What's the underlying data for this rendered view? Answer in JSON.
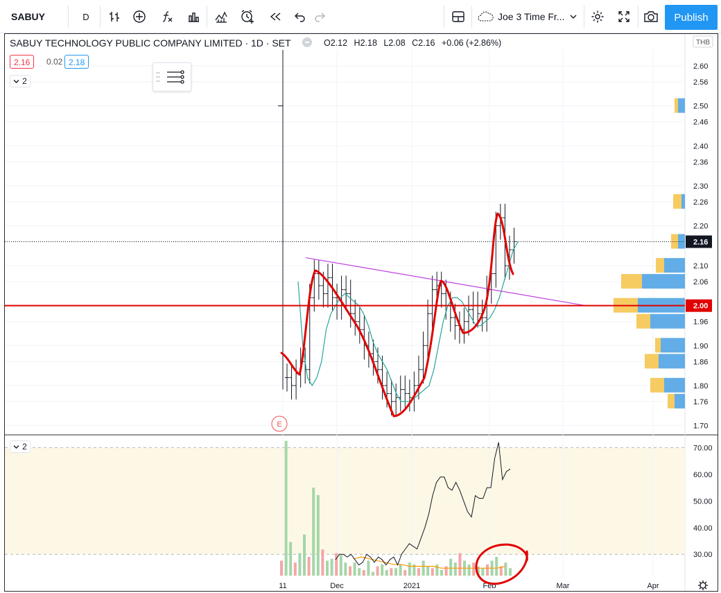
{
  "toolbar": {
    "symbol": "SABUY",
    "interval": "D",
    "layout_name": "Joe 3 Time Fr...",
    "publish_label": "Publish",
    "icons": [
      "bar-style-icon",
      "add-compare-icon",
      "indicators-icon",
      "financials-icon",
      "templates-icon",
      "alert-icon",
      "replay-icon",
      "undo-icon",
      "redo-icon",
      "layout-icon",
      "cloud-icon",
      "settings-icon",
      "fullscreen-icon",
      "camera-icon"
    ]
  },
  "legend": {
    "title": "SABUY TECHNOLOGY PUBLIC COMPANY LIMITED · 1D · SET",
    "open": "O2.12",
    "high": "H2.18",
    "low": "L2.08",
    "close": "C2.16",
    "change": "+0.06 (+2.86%)",
    "bid": "2.16",
    "spread": "0.02",
    "ask": "2.18",
    "pane_count": "2",
    "volume_pane_count": "2"
  },
  "colors": {
    "up": "#26a69a",
    "down": "#ef5350",
    "accent": "#2196f3",
    "trendline": "#c040e0",
    "horizontal_line": "#e00000",
    "annotation": "#e00000"
  },
  "chart_data": [
    {
      "type": "bar",
      "title": "SABUY TECHNOLOGY PUBLIC COMPANY LIMITED · 1D · SET",
      "currency": "THB",
      "y_ticks": [
        "1.70",
        "1.76",
        "1.80",
        "1.86",
        "1.90",
        "1.96",
        "2.00",
        "2.06",
        "2.10",
        "2.16",
        "2.20",
        "2.26",
        "2.30",
        "2.36",
        "2.40",
        "2.46",
        "2.50",
        "2.56",
        "2.60"
      ],
      "ylim": [
        1.68,
        2.64
      ],
      "x_ticks": [
        "11",
        "Dec",
        "2021",
        "Feb",
        "Mar",
        "Apr"
      ],
      "last_price": "2.16",
      "horizontal_level": "2.00",
      "earnings_marker": "E",
      "ohlc_close_path": [
        1.82,
        1.8,
        1.83,
        1.86,
        1.84,
        2.02,
        2.08,
        2.05,
        2.03,
        2.07,
        2.02,
        2.0,
        2.04,
        2.03,
        1.98,
        1.96,
        1.94,
        1.9,
        1.88,
        1.86,
        1.84,
        1.8,
        1.78,
        1.76,
        1.77,
        1.79,
        1.78,
        1.77,
        1.8,
        1.84,
        1.9,
        1.98,
        2.04,
        2.05,
        2.03,
        2.0,
        1.97,
        1.95,
        1.94,
        1.96,
        1.99,
        2.0,
        1.98,
        1.97,
        2.04,
        2.08,
        2.2,
        2.22,
        2.1,
        2.14,
        2.16
      ],
      "moving_average": [
        2.06,
        1.9,
        1.82,
        1.8,
        1.82,
        1.86,
        1.94,
        1.98,
        2.0,
        2.02,
        2.03,
        2.02,
        2.01,
        2.0,
        1.98,
        1.95,
        1.91,
        1.88,
        1.86,
        1.84,
        1.81,
        1.78,
        1.76,
        1.76,
        1.76,
        1.77,
        1.78,
        1.79,
        1.8,
        1.84,
        1.9,
        1.96,
        2.0,
        2.02,
        2.02,
        2.01,
        1.99,
        1.97,
        1.95,
        1.95,
        1.96,
        1.97,
        1.99,
        2.02,
        2.06,
        2.1,
        2.14,
        2.16
      ],
      "volume_profile": [
        {
          "price": 2.5,
          "up": 0.1,
          "down": 0.05
        },
        {
          "price": 2.26,
          "up": 0.05,
          "down": 0.12
        },
        {
          "price": 2.16,
          "up": 0.1,
          "down": 0.1
        },
        {
          "price": 2.1,
          "up": 0.3,
          "down": 0.12
        },
        {
          "price": 2.06,
          "up": 0.62,
          "down": 0.3
        },
        {
          "price": 2.0,
          "up": 0.68,
          "down": 0.35
        },
        {
          "price": 1.96,
          "up": 0.5,
          "down": 0.2
        },
        {
          "price": 1.9,
          "up": 0.35,
          "down": 0.08
        },
        {
          "price": 1.86,
          "up": 0.38,
          "down": 0.2
        },
        {
          "price": 1.8,
          "up": 0.3,
          "down": 0.2
        },
        {
          "price": 1.76,
          "up": 0.15,
          "down": 0.1
        }
      ]
    },
    {
      "type": "line",
      "title": "",
      "y_ticks": [
        "30.00",
        "40.00",
        "50.00",
        "60.00",
        "70.00"
      ],
      "ylim": [
        22,
        74
      ],
      "series": [
        {
          "values": [
            28,
            30,
            30,
            29,
            30,
            28,
            26,
            27,
            30,
            29,
            27,
            29,
            28,
            26,
            28,
            29,
            26,
            30,
            32,
            34,
            33,
            32,
            36,
            40,
            45,
            52,
            57,
            59,
            59,
            55,
            54,
            57,
            54,
            50,
            46,
            44,
            52,
            51,
            51,
            55,
            55,
            66,
            72,
            58,
            61,
            62
          ]
        }
      ],
      "volume_bars": [
        8,
        72,
        18,
        7,
        12,
        22,
        10,
        47,
        43,
        14,
        8,
        9,
        12,
        11,
        7,
        5,
        7,
        4,
        3,
        8,
        2,
        5,
        6,
        3,
        4,
        4,
        6,
        3,
        7,
        6,
        4,
        8,
        5,
        4,
        6,
        3,
        5,
        9,
        7,
        12,
        8,
        6,
        7,
        5,
        4,
        6,
        8,
        10,
        5,
        7,
        4
      ],
      "volume_ma": [
        9,
        10,
        9,
        8,
        7,
        6,
        6,
        5,
        5,
        5,
        5,
        4,
        4,
        4,
        4,
        4,
        4,
        4,
        4,
        5
      ]
    }
  ]
}
